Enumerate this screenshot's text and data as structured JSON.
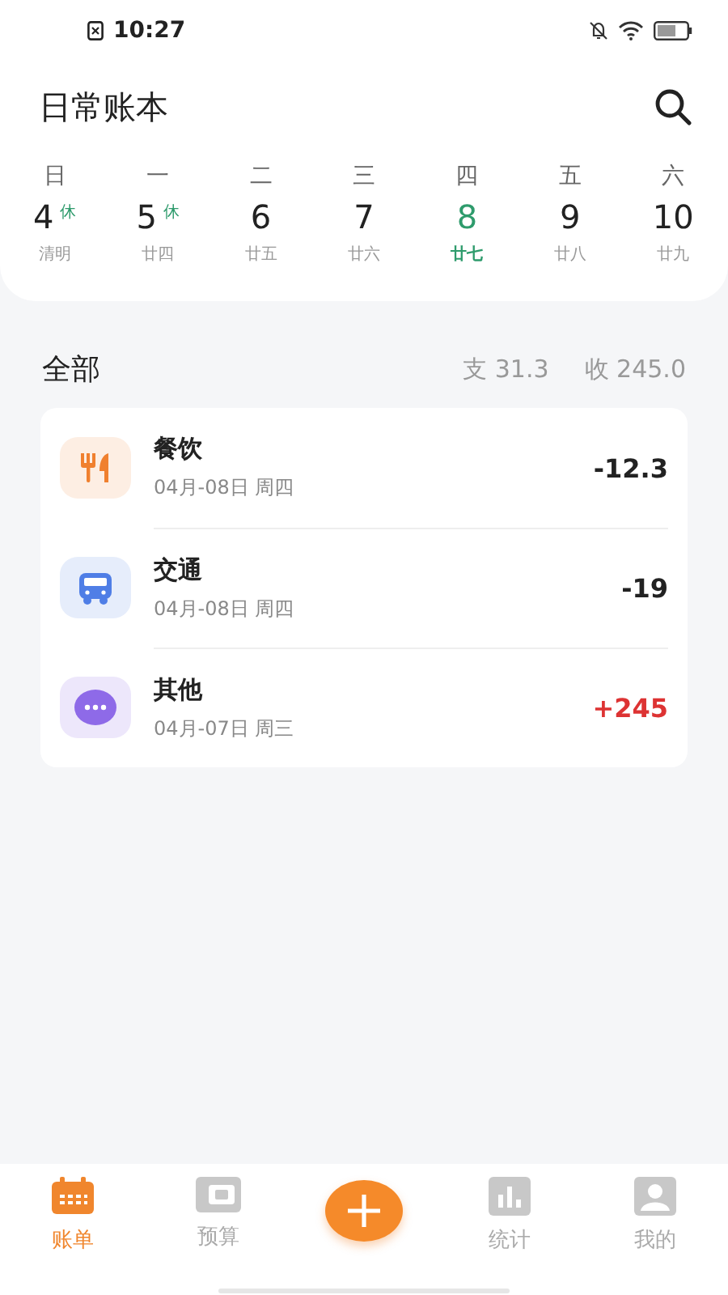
{
  "status_bar": {
    "time": "10:27"
  },
  "header": {
    "title": "日常账本"
  },
  "week": [
    {
      "weekday": "日",
      "date": "4",
      "badge": "休",
      "lunar": "清明",
      "selected": false
    },
    {
      "weekday": "一",
      "date": "5",
      "badge": "休",
      "lunar": "廿四",
      "selected": false
    },
    {
      "weekday": "二",
      "date": "6",
      "lunar": "廿五",
      "selected": false
    },
    {
      "weekday": "三",
      "date": "7",
      "lunar": "廿六",
      "selected": false
    },
    {
      "weekday": "四",
      "date": "8",
      "lunar": "廿七",
      "selected": true
    },
    {
      "weekday": "五",
      "date": "9",
      "lunar": "廿八",
      "selected": false
    },
    {
      "weekday": "六",
      "date": "10",
      "lunar": "廿九",
      "selected": false
    }
  ],
  "summary": {
    "title": "全部",
    "expense": "支 31.3",
    "income": "收 245.0"
  },
  "records": [
    {
      "kind": "food",
      "name": "餐饮",
      "date": "04月-08日 周四",
      "amount": "-12.3",
      "income": false
    },
    {
      "kind": "transport",
      "name": "交通",
      "date": "04月-08日 周四",
      "amount": "-19",
      "income": false
    },
    {
      "kind": "other",
      "name": "其他",
      "date": "04月-07日 周三",
      "amount": "+245",
      "income": true
    }
  ],
  "tabs": [
    {
      "kind": "calendar",
      "label": "账单",
      "selected": true
    },
    {
      "kind": "wallet",
      "label": "预算",
      "selected": false
    },
    {
      "kind": "add"
    },
    {
      "kind": "chart",
      "label": "统计",
      "selected": false
    },
    {
      "kind": "person",
      "label": "我的",
      "selected": false
    }
  ]
}
